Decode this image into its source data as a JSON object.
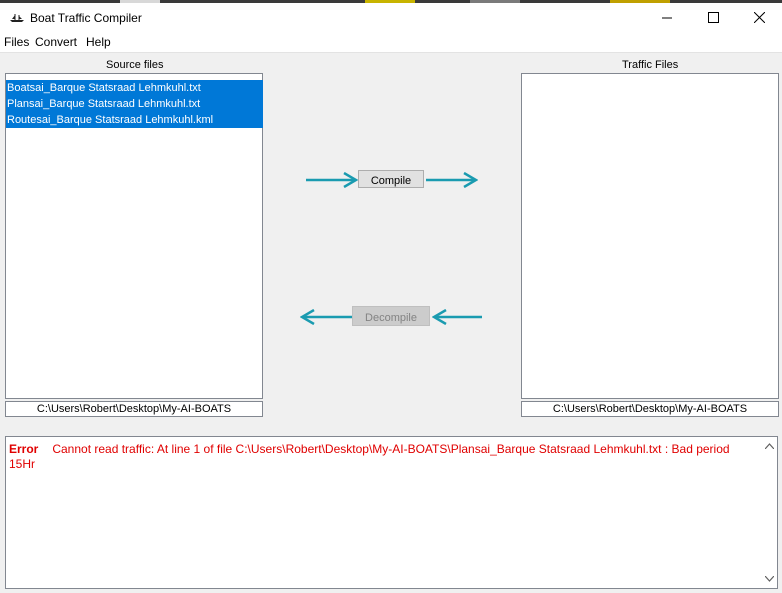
{
  "window": {
    "title": "Boat Traffic Compiler",
    "controls": {
      "minimize": "—",
      "maximize": "☐",
      "close": "✕"
    }
  },
  "menu": {
    "items": [
      "Files",
      "Convert",
      "Help"
    ]
  },
  "source": {
    "label": "Source files",
    "files": [
      "Boatsai_Barque Statsraad Lehmkuhl.txt",
      "Plansai_Barque Statsraad Lehmkuhl.txt",
      "Routesai_Barque Statsraad Lehmkuhl.kml"
    ],
    "path": "C:\\Users\\Robert\\Desktop\\My-AI-BOATS"
  },
  "traffic": {
    "label": "Traffic Files",
    "files": [],
    "path": "C:\\Users\\Robert\\Desktop\\My-AI-BOATS"
  },
  "actions": {
    "compile": "Compile",
    "decompile": "Decompile",
    "compile_enabled": true,
    "decompile_enabled": false,
    "arrow_color": "#1a9bb0"
  },
  "log": {
    "level": "Error",
    "message": "Cannot read traffic: At line 1 of file C:\\Users\\Robert\\Desktop\\My-AI-BOATS\\Plansai_Barque Statsraad Lehmkuhl.txt : Bad period 15Hr",
    "color": "#e00000"
  },
  "colors": {
    "selection": "#0078d7",
    "accent": "#1a9bb0"
  }
}
